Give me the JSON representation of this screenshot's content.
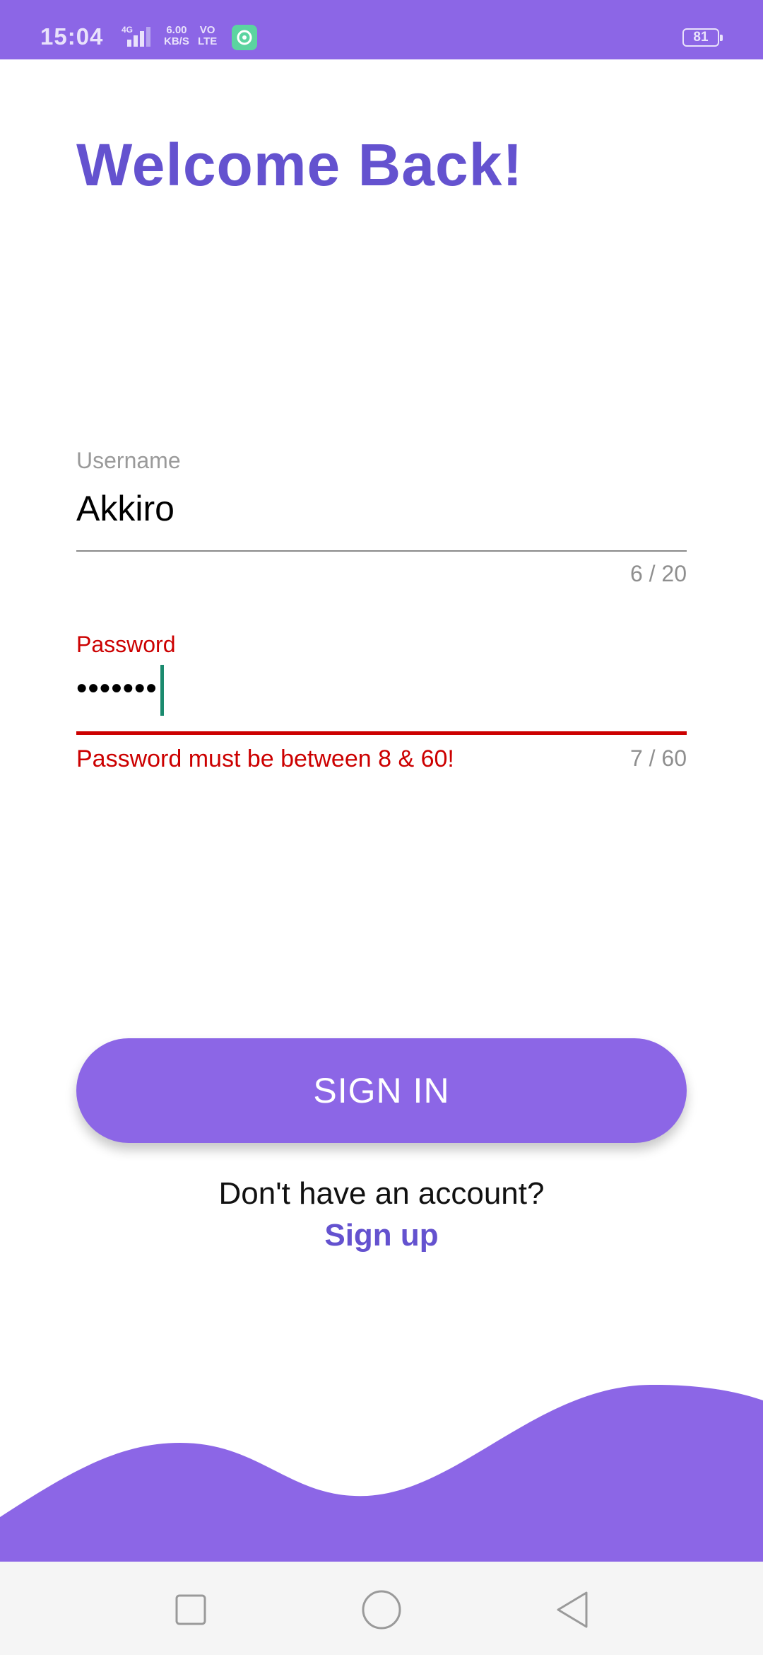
{
  "status_bar": {
    "time": "15:04",
    "network": "4G",
    "speed_value": "6.00",
    "speed_unit": "KB/S",
    "volte_top": "VO",
    "volte_bottom": "LTE",
    "battery": "81"
  },
  "title": "Welcome Back!",
  "username": {
    "label": "Username",
    "value": "Akkiro",
    "counter": "6 / 20"
  },
  "password": {
    "label": "Password",
    "value": "•••••••",
    "counter": "7 / 60",
    "error": "Password must be between 8 & 60!"
  },
  "sign_in_button": "SIGN IN",
  "no_account_text": "Don't have an account?",
  "sign_up_link": "Sign up",
  "colors": {
    "accent": "#8c66e6",
    "title": "#6452cf",
    "error": "#cc0000",
    "cursor": "#1a8a6e"
  },
  "icons": {
    "nav_recents": "square-icon",
    "nav_home": "circle-icon",
    "nav_back": "triangle-back-icon"
  }
}
